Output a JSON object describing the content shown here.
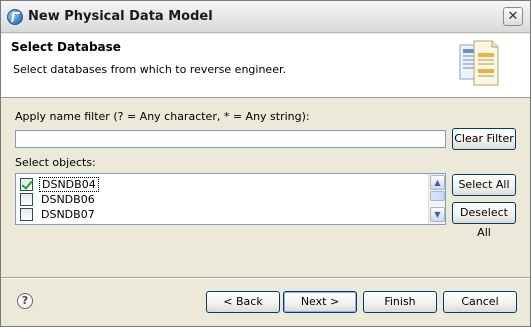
{
  "window": {
    "title": "New Physical Data Model",
    "close_glyph": "✕"
  },
  "header": {
    "title": "Select Database",
    "description": "Select databases from which to reverse engineer.",
    "icon": "data-model-wizard-icon"
  },
  "filter": {
    "label": "Apply name filter (? = Any character, * = Any string):",
    "value": "",
    "clear_label": "Clear Filter"
  },
  "objects": {
    "label": "Select objects:",
    "items": [
      {
        "label": "DSNDB04",
        "checked": true
      },
      {
        "label": "DSNDB06",
        "checked": false
      },
      {
        "label": "DSNDB07",
        "checked": false
      }
    ],
    "select_all_label": "Select All",
    "deselect_all_label": "Deselect All"
  },
  "footer": {
    "help_glyph": "?",
    "back_label": "< Back",
    "next_label": "Next >",
    "finish_label": "Finish",
    "cancel_label": "Cancel"
  }
}
